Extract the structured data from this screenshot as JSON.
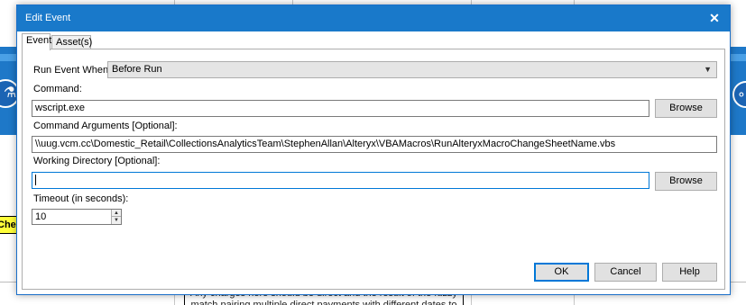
{
  "window": {
    "title": "Edit Event",
    "close_glyph": "✕"
  },
  "tabs": [
    {
      "label": "Event",
      "active": true
    },
    {
      "label": "Asset(s)",
      "active": false
    }
  ],
  "form": {
    "run_event_when": {
      "label": "Run Event When:",
      "value": "Before Run"
    },
    "command": {
      "label": "Command:",
      "value": "wscript.exe",
      "browse_label": "Browse"
    },
    "command_arguments": {
      "label": "Command Arguments [Optional]:",
      "value": "\\\\uug.vcm.cc\\Domestic_Retail\\CollectionsAnalyticsTeam\\StephenAllan\\Alteryx\\VBAMacros\\RunAlteryxMacroChangeSheetName.vbs"
    },
    "working_directory": {
      "label": "Working Directory [Optional]:",
      "value": "",
      "browse_label": "Browse"
    },
    "timeout": {
      "label": "Timeout (in seconds):",
      "value": "10"
    }
  },
  "buttons": {
    "ok": "OK",
    "cancel": "Cancel",
    "help": "Help"
  },
  "background": {
    "yellow_tag": "Chec",
    "note_text": "Any charges here should be direct and the result of the fuzzy match pairing multiple direct payments with different dates to the same"
  },
  "colors": {
    "titlebar": "#1979ca",
    "accent": "#0078d7",
    "band": "#1e78c8"
  }
}
